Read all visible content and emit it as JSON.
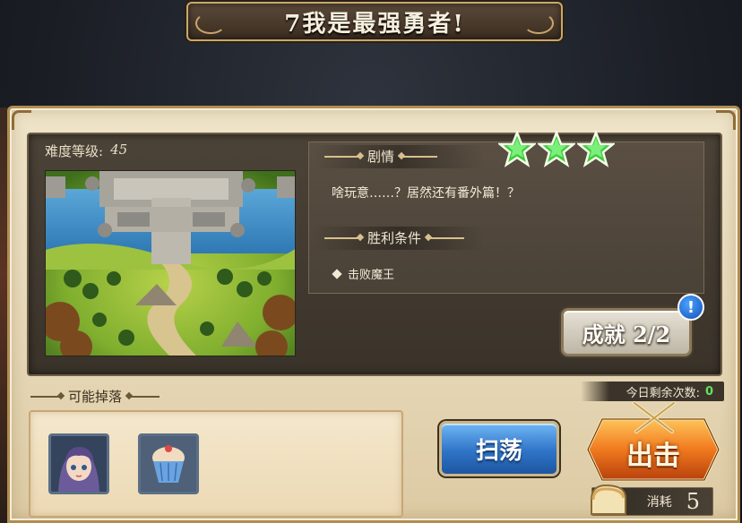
{
  "title": "7我是最强勇者!",
  "difficulty": {
    "label": "难度等级:",
    "value": "45"
  },
  "stars": {
    "earned": 3,
    "total": 3,
    "color": "#3ec83e"
  },
  "story": {
    "header": "剧情",
    "text": "啥玩意……？居然还有番外篇！？"
  },
  "victory": {
    "header": "胜利条件",
    "condition": "击败魔王"
  },
  "achievement": {
    "label": "成就 2/2",
    "badge": "!"
  },
  "drops": {
    "header": "可能掉落",
    "items": [
      "character-card-icon",
      "cupcake-icon"
    ]
  },
  "remaining": {
    "label": "今日剩余次数:",
    "value": "0"
  },
  "sweep": {
    "label": "扫荡"
  },
  "sortie": {
    "label": "出击"
  },
  "cost": {
    "label": "消耗",
    "value": "5",
    "icon": "bread-icon"
  }
}
